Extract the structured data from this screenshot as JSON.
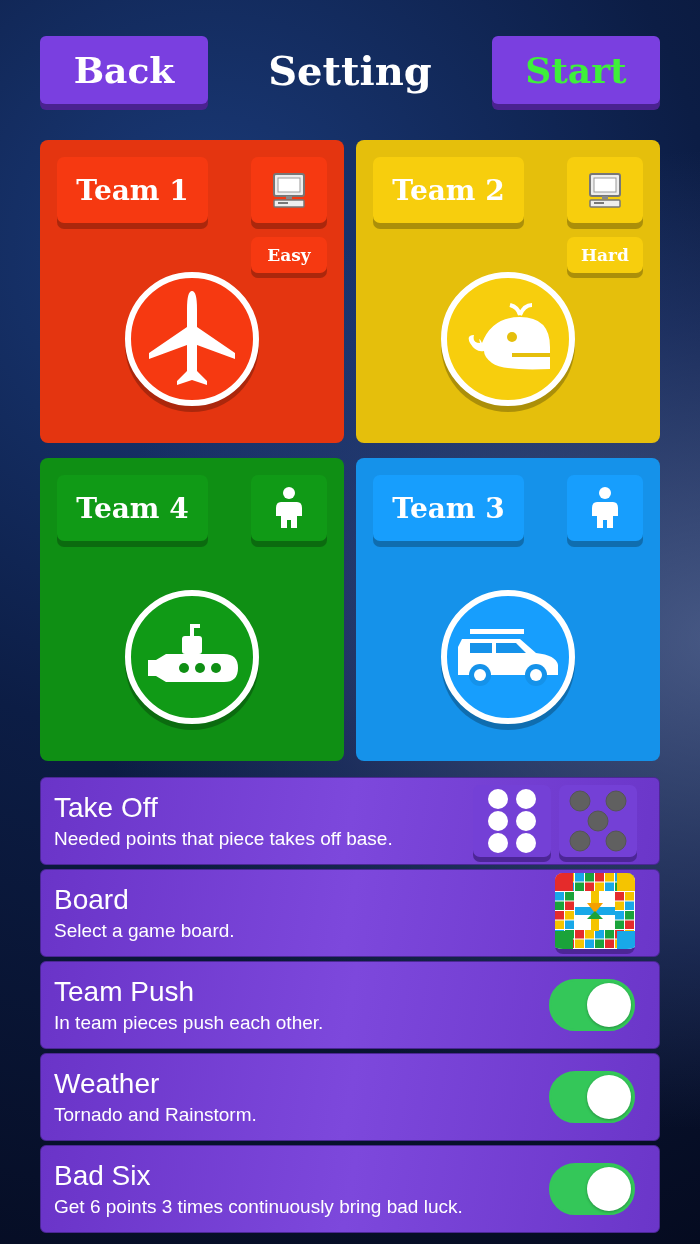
{
  "header": {
    "back": "Back",
    "title": "Setting",
    "start": "Start"
  },
  "teams": [
    {
      "name": "Team 1",
      "color": "#e43510",
      "player": {
        "kind": "computer"
      },
      "difficulty": "Easy",
      "emblem": {
        "kind": "plane"
      }
    },
    {
      "name": "Team 2",
      "color": "#e5bf0c",
      "player": {
        "kind": "computer"
      },
      "difficulty": "Hard",
      "emblem": {
        "kind": "whale"
      }
    },
    {
      "name": "Team 4",
      "color": "#0f8f14",
      "player": {
        "kind": "human"
      },
      "emblem": {
        "kind": "submarine"
      }
    },
    {
      "name": "Team 3",
      "color": "#1592ea",
      "player": {
        "kind": "human"
      },
      "emblem": {
        "kind": "car"
      }
    }
  ],
  "settings": [
    {
      "kind": "dice",
      "title": "Take Off",
      "description": "Needed points that piece takes off base.",
      "dice": [
        {
          "kind": "six",
          "selected": true
        },
        {
          "kind": "five",
          "selected": false
        }
      ]
    },
    {
      "kind": "board",
      "title": "Board",
      "description": "Select a game board."
    },
    {
      "kind": "toggle",
      "title": "Team Push",
      "description": "In team pieces push each other.",
      "on": true
    },
    {
      "kind": "toggle",
      "title": "Weather",
      "description": "Tornado and Rainstorm.",
      "on": true
    },
    {
      "kind": "toggle",
      "title": "Bad Six",
      "description": "Get 6 points 3 times continuously bring bad luck.",
      "on": true
    }
  ]
}
